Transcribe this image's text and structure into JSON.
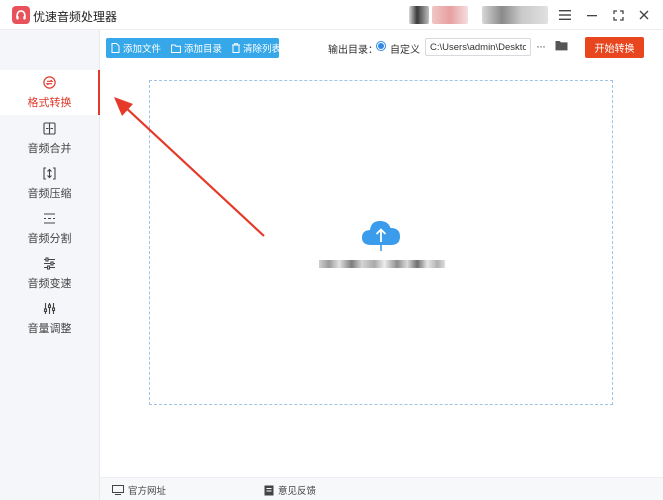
{
  "app": {
    "title": "优速音频处理器"
  },
  "colors": {
    "accent_red": "#e03a2b",
    "toolbar_blue": "#36a8ea",
    "start_orange": "#e8461e",
    "cloud_blue": "#3a9cea"
  },
  "sidebar": {
    "items": [
      {
        "label": "格式转换",
        "icon": "format-convert-icon",
        "active": true
      },
      {
        "label": "音频合并",
        "icon": "merge-icon",
        "active": false
      },
      {
        "label": "音频压缩",
        "icon": "compress-icon",
        "active": false
      },
      {
        "label": "音频分割",
        "icon": "split-icon",
        "active": false
      },
      {
        "label": "音频变速",
        "icon": "speed-icon",
        "active": false
      },
      {
        "label": "音量调整",
        "icon": "volume-icon",
        "active": false
      }
    ]
  },
  "toolbar": {
    "add_file": "添加文件",
    "add_dir": "添加目录",
    "clear_list": "清除列表"
  },
  "output": {
    "label": "输出目录：",
    "mode": "自定义",
    "path": "C:\\Users\\admin\\Deskto",
    "more": "···",
    "start": "开始转换"
  },
  "footer": {
    "website": "官方网址",
    "feedback": "意见反馈"
  }
}
